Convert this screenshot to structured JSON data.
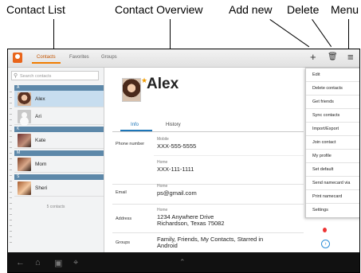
{
  "callouts": {
    "contact_list": "Contact List",
    "contact_overview": "Contact Overview",
    "add_new": "Add new",
    "delete": "Delete",
    "menu": "Menu"
  },
  "actionbar": {
    "tabs": [
      "Contacts",
      "Favorites",
      "Groups"
    ]
  },
  "sidebar": {
    "search_placeholder": "Search contacts",
    "sections": [
      "A",
      "K",
      "M",
      "S"
    ],
    "contacts": [
      {
        "name": "Alex",
        "selected": true
      },
      {
        "name": "Ari"
      },
      {
        "name": "Kate"
      },
      {
        "name": "Mom"
      },
      {
        "name": "Sheri"
      }
    ],
    "count_text": "5 contacts"
  },
  "main": {
    "name": "Alex",
    "tabs": [
      "Info",
      "History"
    ],
    "fields": {
      "phone_label": "Phone number",
      "mobile_label": "Mobile",
      "mobile_value": "XXX-555-5555",
      "home_label": "Home",
      "home_value": "XXX-111-1111",
      "email_label": "Email",
      "email_home_label": "Home",
      "email_value": "ps@gmail.com",
      "address_label": "Address",
      "address_home_label": "Home",
      "address_line1": "1234 Anywhere Drive",
      "address_line2": "Richardson, Texas 75082",
      "groups_label": "Groups",
      "groups_line1": "Family, Friends, My Contacts, Starred in",
      "groups_line2": "Android"
    }
  },
  "menu": {
    "items": [
      "Edit",
      "Delete contacts",
      "Get friends",
      "Sync contacts",
      "Import/Export",
      "Join contact",
      "My profile",
      "Set default",
      "Send namecard via",
      "Print namecard",
      "Settings"
    ]
  },
  "colors": {
    "accent": "#f07c00",
    "section_header": "#5d88a9",
    "selected_row": "#c7ddef",
    "link_blue": "#1d76b8"
  }
}
